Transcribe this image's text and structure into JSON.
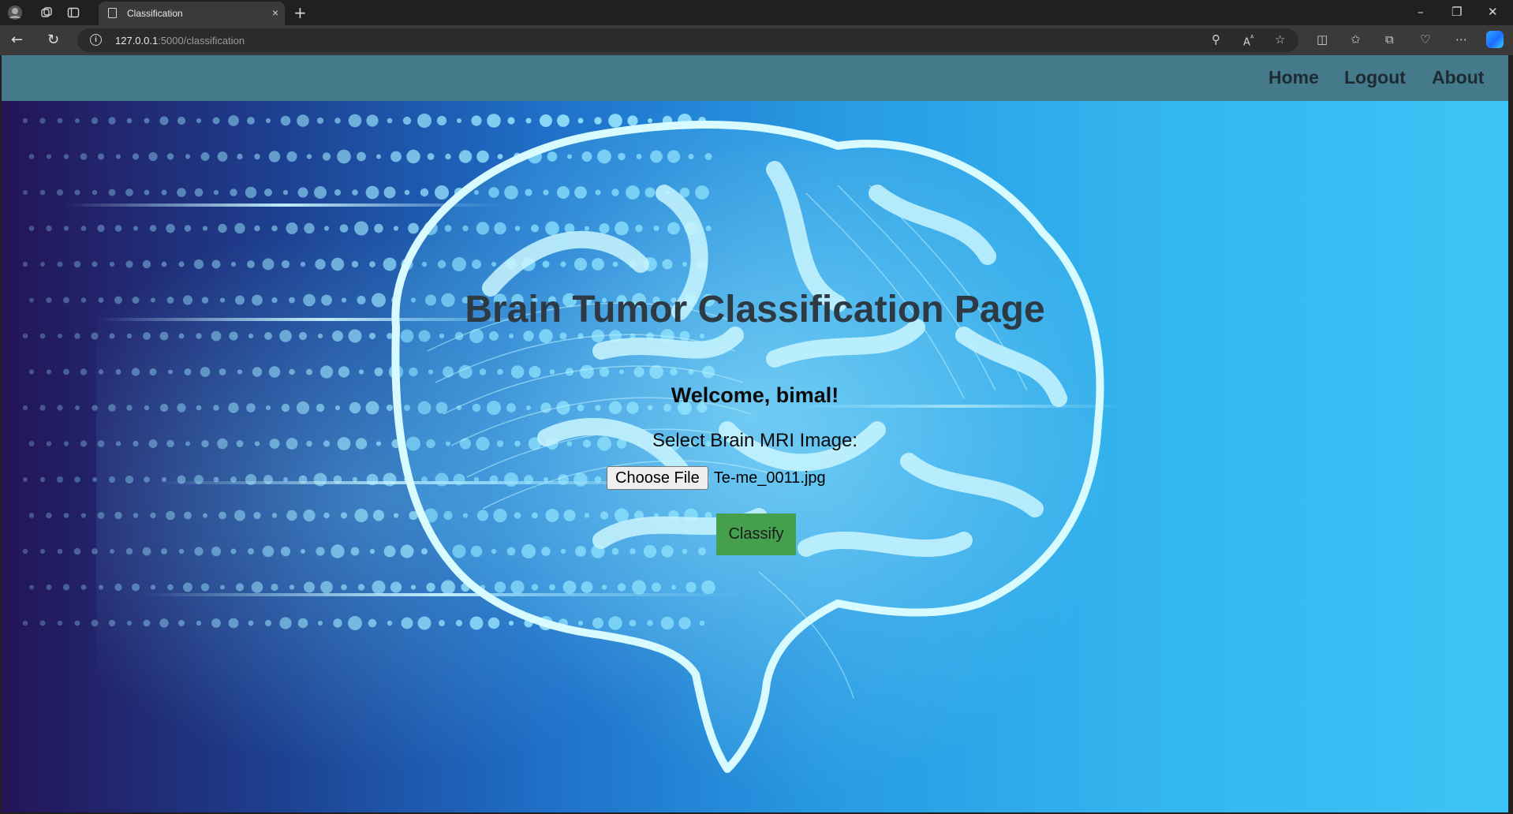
{
  "browser": {
    "tab_title": "Classification",
    "tab_close": "×",
    "new_tab": "+",
    "url_host": "127.0.0.1",
    "url_rest": ":5000/classification",
    "window_controls": [
      "–",
      "❐",
      "✕"
    ]
  },
  "navbar": {
    "links": [
      "Home",
      "Logout",
      "About"
    ]
  },
  "main": {
    "title": "Brain Tumor Classification Page",
    "welcome": "Welcome, bimal!",
    "select_label": "Select Brain MRI Image:",
    "choose_file_label": "Choose File",
    "file_name": "Te-me_0011.jpg",
    "classify_label": "Classify"
  },
  "colors": {
    "navbar": "#457a8a",
    "classify_button": "#45a04d",
    "background_left": "#241457",
    "background_right": "#3dc4f6"
  }
}
